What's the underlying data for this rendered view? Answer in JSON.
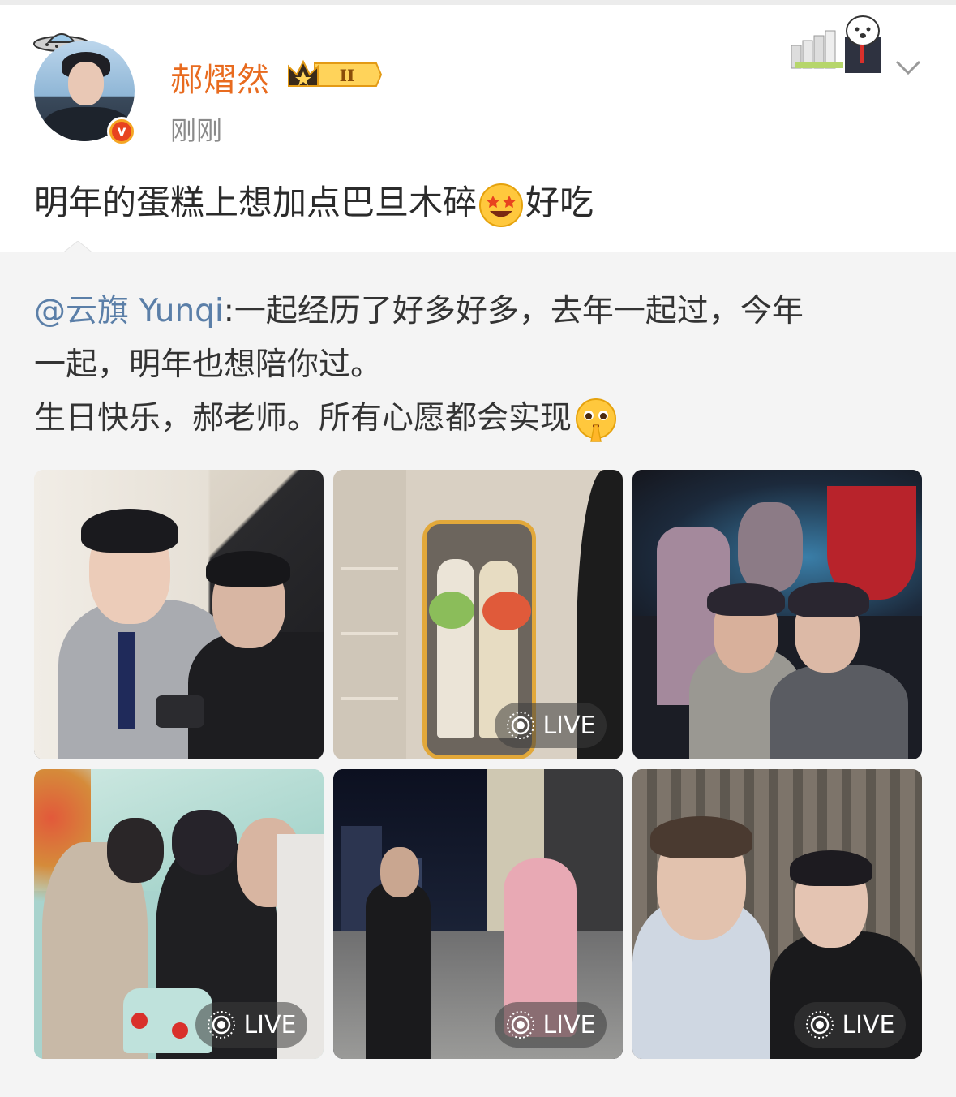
{
  "post": {
    "username": "郝熠然",
    "vip_level": "II",
    "time": "刚刚",
    "text_before": "明年的蛋糕上想加点巴旦木碎",
    "text_after": "好吃"
  },
  "repost": {
    "mention": "@云旗 Yunqi",
    "text_line1": ":一起经历了好多好多，去年一起过，今年",
    "text_line2": "一起，明年也想陪你过。",
    "text_line3": "生日快乐，郝老师。所有心愿都会实现"
  },
  "photos": [
    {
      "live": false
    },
    {
      "live": true,
      "live_label": "LIVE"
    },
    {
      "live": false
    },
    {
      "live": true,
      "live_label": "LIVE"
    },
    {
      "live": true,
      "live_label": "LIVE"
    },
    {
      "live": true,
      "live_label": "LIVE"
    }
  ],
  "icons": {
    "verified": "verified-v-icon",
    "chevron": "chevron-down-icon",
    "live": "live-photo-icon"
  },
  "colors": {
    "username": "#e86b1f",
    "mention": "#5b7fa8",
    "verified": "#f5a623"
  }
}
